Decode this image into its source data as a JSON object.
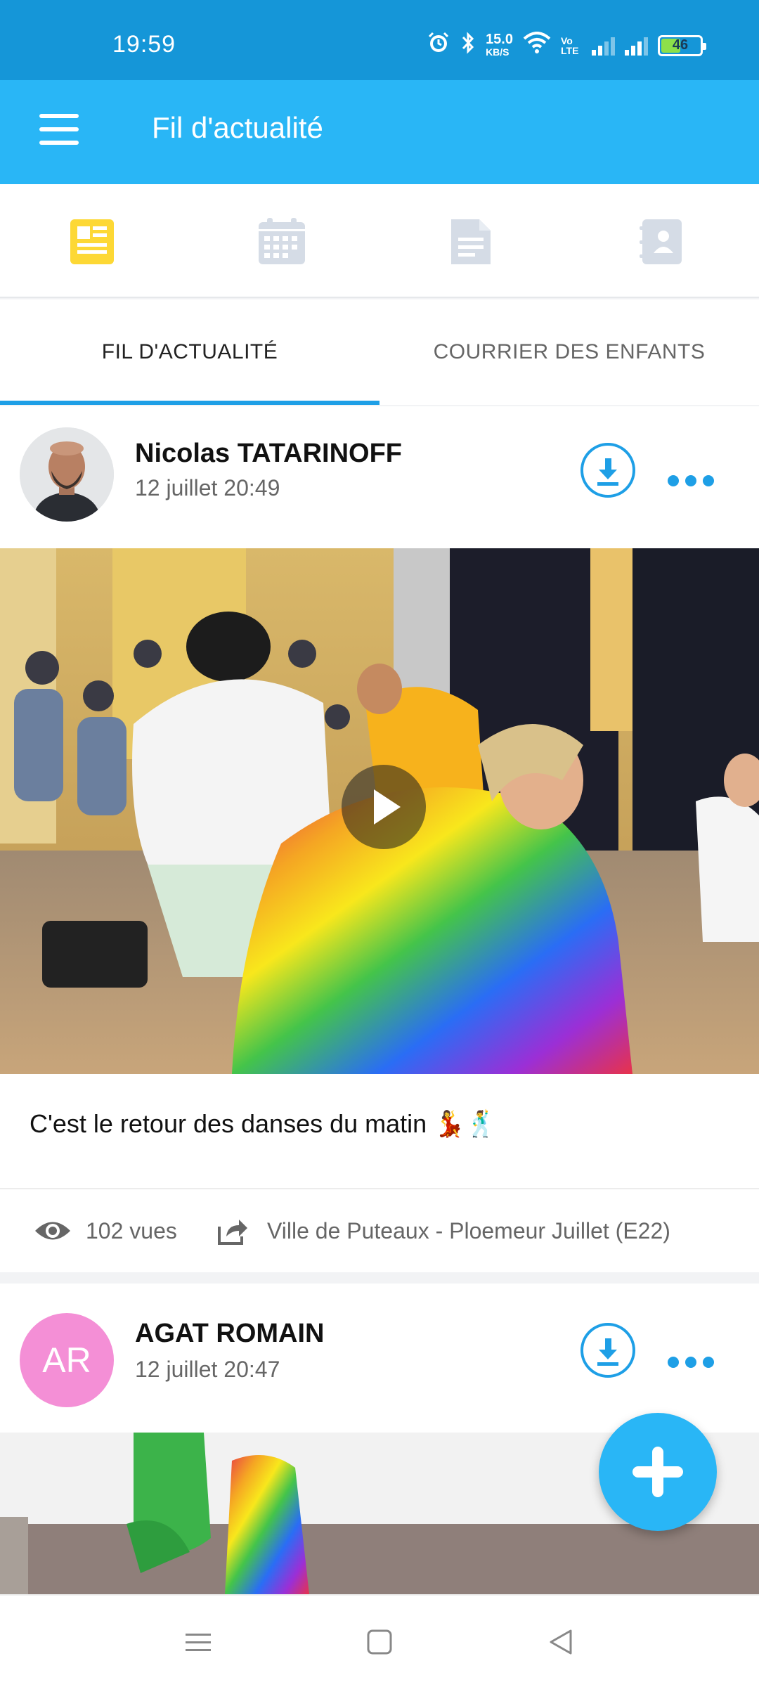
{
  "status_bar": {
    "time": "19:59",
    "net_speed": "15.0",
    "net_unit": "KB/S",
    "volte": "Vo LTE",
    "battery": "46",
    "icons": [
      "alarm-icon",
      "bluetooth-icon",
      "wifi-icon",
      "signal-icon"
    ]
  },
  "app_bar": {
    "title": "Fil d'actualité",
    "menu_icon": "hamburger-menu-icon"
  },
  "icon_tabs": [
    {
      "name": "news-feed-icon",
      "active": true
    },
    {
      "name": "calendar-icon",
      "active": false
    },
    {
      "name": "document-icon",
      "active": false
    },
    {
      "name": "contacts-book-icon",
      "active": false
    }
  ],
  "tabs": [
    {
      "label": "FIL D'ACTUALITÉ",
      "active": true
    },
    {
      "label": "COURRIER DES ENFANTS",
      "active": false
    }
  ],
  "posts": [
    {
      "author": "Nicolas TATARINOFF",
      "date": "12 juillet 20:49",
      "media": "video",
      "caption": "C'est le retour des danses du matin 💃🕺",
      "views": "102 vues",
      "group": "Ville de Puteaux - Ploemeur Juillet (E22)"
    },
    {
      "author": "AGAT ROMAIN",
      "initials": "AR",
      "date": "12 juillet 20:47",
      "media": "image"
    }
  ],
  "colors": {
    "status_bar": "#1596d8",
    "app_bar": "#29b6f6",
    "accent": "#1e9fe6",
    "active_icon": "#fdd835",
    "inactive_icon": "#d5dce6",
    "avatar_ar": "#f48fd6"
  }
}
